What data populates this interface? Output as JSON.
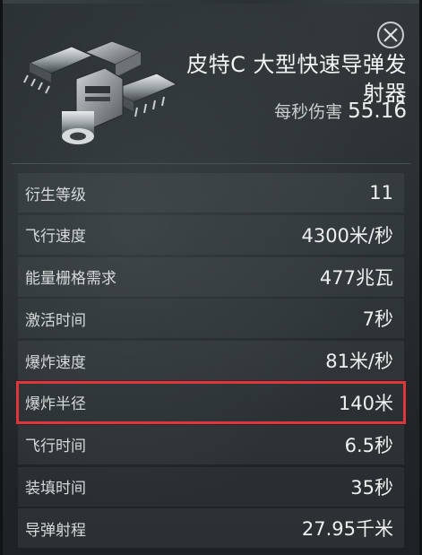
{
  "item": {
    "title": "皮特C 大型快速导弹发射器",
    "dps_label": "每秒伤害",
    "dps_value": "55.16",
    "image_icon": "missile-launcher-icon"
  },
  "close": {
    "icon": "close-icon"
  },
  "stats": [
    {
      "label": "衍生等级",
      "value": "11",
      "highlight": false
    },
    {
      "label": "飞行速度",
      "value": "4300米/秒",
      "highlight": false
    },
    {
      "label": "能量栅格需求",
      "value": "477兆瓦",
      "highlight": false
    },
    {
      "label": "激活时间",
      "value": "7秒",
      "highlight": false
    },
    {
      "label": "爆炸速度",
      "value": "81米/秒",
      "highlight": false
    },
    {
      "label": "爆炸半径",
      "value": "140米",
      "highlight": true
    },
    {
      "label": "飞行时间",
      "value": "6.5秒",
      "highlight": false
    },
    {
      "label": "装填时间",
      "value": "35秒",
      "highlight": false
    },
    {
      "label": "导弹射程",
      "value": "27.95千米",
      "highlight": false
    }
  ],
  "colors": {
    "highlight_border": "#e0353a",
    "text": "#eef0f0",
    "row_bg": "#3a4245"
  }
}
